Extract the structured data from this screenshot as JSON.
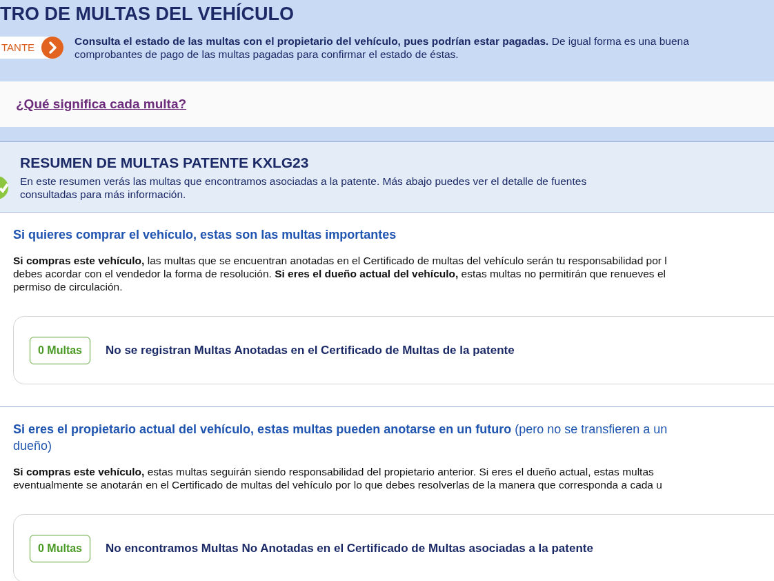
{
  "header": {
    "title": "TRO DE MULTAS DEL VEHÍCULO",
    "notice_label": "TANTE",
    "notice_lines": [
      "**Consulta el estado de las multas con el propietario del vehículo, pues podrían estar pagadas.** De igual forma es una buena",
      "comprobantes de pago de las multas pagadas para confirmar el estado de éstas."
    ]
  },
  "link": "¿Qué significa cada multa?",
  "summary": {
    "title": "RESUMEN DE MULTAS PATENTE KXLG23",
    "lines": [
      "En este resumen verás las multas que encontramos asociadas a la patente. Más abajo puedes ver el detalle de fuentes",
      "consultadas para más información."
    ]
  },
  "sections": [
    {
      "heading": "Si quieres comprar el vehículo, estas son las multas importantes",
      "paragraph_lines": [
        "**Si compras este vehículo,** las multas que se encuentran anotadas en el Certificado de multas del vehículo serán tu responsabilidad por l",
        "debes acordar con el vendedor la forma de resolución. **Si eres el dueño actual del vehículo,** estas multas no permitirán que renueves el",
        "permiso de circulación."
      ],
      "card": {
        "badge": "0 Multas",
        "message": "No se registran Multas Anotadas en el Certificado de Multas de la patente"
      }
    },
    {
      "heading": "Si eres el propietario actual del vehículo, estas multas pueden anotarse en un futuro",
      "heading_note_lines": [
        "(pero no se transfieren a un",
        "dueño)"
      ],
      "paragraph_lines": [
        "**Si compras este vehículo,** estas multas seguirán siendo responsabilidad del propietario anterior. Si eres el dueño actual, estas multas",
        "eventualmente se anotarán en el Certificado de multas del vehículo por lo que debes resolverlas de la manera que corresponda a cada u"
      ],
      "card": {
        "badge": "0 Multas",
        "message": "No encontramos Multas No Anotadas en el Certificado de Multas asociadas a la patente"
      }
    }
  ]
}
